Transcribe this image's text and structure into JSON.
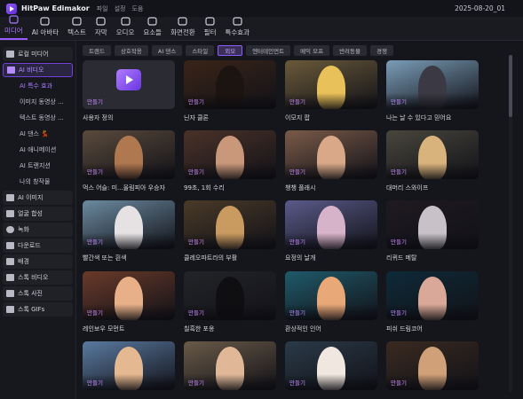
{
  "app": {
    "name": "HitPaw Edimakor",
    "menu": [
      "파일",
      "설정",
      "도움"
    ],
    "date": "2025-08-20_01"
  },
  "toolbar": [
    {
      "label": "미디어",
      "icon": "media-icon",
      "active": true
    },
    {
      "label": "AI 아바타",
      "icon": "avatar-icon"
    },
    {
      "label": "텍스트",
      "icon": "text-icon"
    },
    {
      "label": "자막",
      "icon": "subtitle-icon"
    },
    {
      "label": "오디오",
      "icon": "audio-icon"
    },
    {
      "label": "요소들",
      "icon": "elements-icon"
    },
    {
      "label": "화면전환",
      "icon": "transition-icon"
    },
    {
      "label": "필터",
      "icon": "filter-icon"
    },
    {
      "label": "특수효과",
      "icon": "effects-icon"
    }
  ],
  "sidebar": [
    {
      "label": "로컬 미디어",
      "type": "top",
      "icon": "folder-icon"
    },
    {
      "label": "AI 비디오",
      "type": "selected",
      "icon": "ai-video-icon"
    },
    {
      "label": "AI 특수 효과",
      "type": "subselected"
    },
    {
      "label": "이미지 동영상 ...",
      "type": "sub"
    },
    {
      "label": "텍스트 동영상 ...",
      "type": "sub"
    },
    {
      "label": "AI 댄스 💃",
      "type": "sub"
    },
    {
      "label": "AI 애니메이션",
      "type": "sub"
    },
    {
      "label": "AI 트랜지션",
      "type": "sub"
    },
    {
      "label": "나의 창작물",
      "type": "sub"
    },
    {
      "label": "AI 이미지",
      "type": "top",
      "icon": "ai-image-icon"
    },
    {
      "label": "얼굴 합성",
      "type": "top",
      "icon": "face-swap-icon"
    },
    {
      "label": "녹화",
      "type": "top",
      "icon": "record-icon"
    },
    {
      "label": "다운로드",
      "type": "top",
      "icon": "download-icon"
    },
    {
      "label": "배경",
      "type": "top",
      "icon": "background-icon"
    },
    {
      "label": "스톡 비디오",
      "type": "top",
      "icon": "stock-video-icon"
    },
    {
      "label": "스톡 사진",
      "type": "top",
      "icon": "stock-photo-icon"
    },
    {
      "label": "스톡 GIFs",
      "type": "top",
      "icon": "stock-gif-icon"
    }
  ],
  "filters": [
    {
      "label": "트렌드"
    },
    {
      "label": "상호작용"
    },
    {
      "label": "AI 댄스"
    },
    {
      "label": "스타일"
    },
    {
      "label": "외모",
      "active": true
    },
    {
      "label": "엔터테인먼트"
    },
    {
      "label": "메익 모프"
    },
    {
      "label": "반려동물"
    },
    {
      "label": "경쟁"
    }
  ],
  "make_label": "만들기",
  "cards": [
    {
      "title": "사용자 정의",
      "bg": "#2b2c33",
      "fig": "",
      "custom": true
    },
    {
      "title": "닌자 클론",
      "bg": "#3a2418",
      "fig": "#1c1410"
    },
    {
      "title": "이모지 팝",
      "bg": "#6a5a3a",
      "fig": "#e9c15a"
    },
    {
      "title": "나는 날 수 있다고 믿어요",
      "bg": "#7a9db8",
      "fig": "#3b3a44"
    },
    {
      "title": "먹스 어슬: 미...올림피아 우승자",
      "bg": "#5a4a3c",
      "fig": "#b0784f"
    },
    {
      "title": "99초, 1회 수리",
      "bg": "#4a3228",
      "fig": "#c9977a"
    },
    {
      "title": "챙챙 플래시",
      "bg": "#7a5a48",
      "fig": "#d8a888"
    },
    {
      "title": "대머리 스와이프",
      "bg": "#48463c",
      "fig": "#d9b37c"
    },
    {
      "title": "빨간색 또는 흰색",
      "bg": "#6b8aa0",
      "fig": "#e6e2e4"
    },
    {
      "title": "클레오파트라의 부활",
      "bg": "#4a3a28",
      "fig": "#c99b60"
    },
    {
      "title": "요정의 날개",
      "bg": "#5a5a8a",
      "fig": "#d6b3c8"
    },
    {
      "title": "리퀴드 메탈",
      "bg": "#1e1a20",
      "fig": "#c8c2c8"
    },
    {
      "title": "레인보우 모먼트",
      "bg": "#6a3a2a",
      "fig": "#e8b088"
    },
    {
      "title": "칠흑한 포옹",
      "bg": "#232428",
      "fig": "#0f0f12"
    },
    {
      "title": "환상적인 인어",
      "bg": "#1f5a6a",
      "fig": "#e8a878"
    },
    {
      "title": "피쉬 드림코어",
      "bg": "#0e2a38",
      "fig": "#d9a898"
    },
    {
      "title": "",
      "bg": "#5a7aa0",
      "fig": "#e4b890"
    },
    {
      "title": "",
      "bg": "#6a5a48",
      "fig": "#e0b898"
    },
    {
      "title": "",
      "bg": "#2a3a48",
      "fig": "#f0e8e0"
    },
    {
      "title": "",
      "bg": "#3a2a20",
      "fig": "#d0a078"
    }
  ],
  "colors": {
    "accent": "#9b5cff",
    "bg": "#15161b"
  }
}
